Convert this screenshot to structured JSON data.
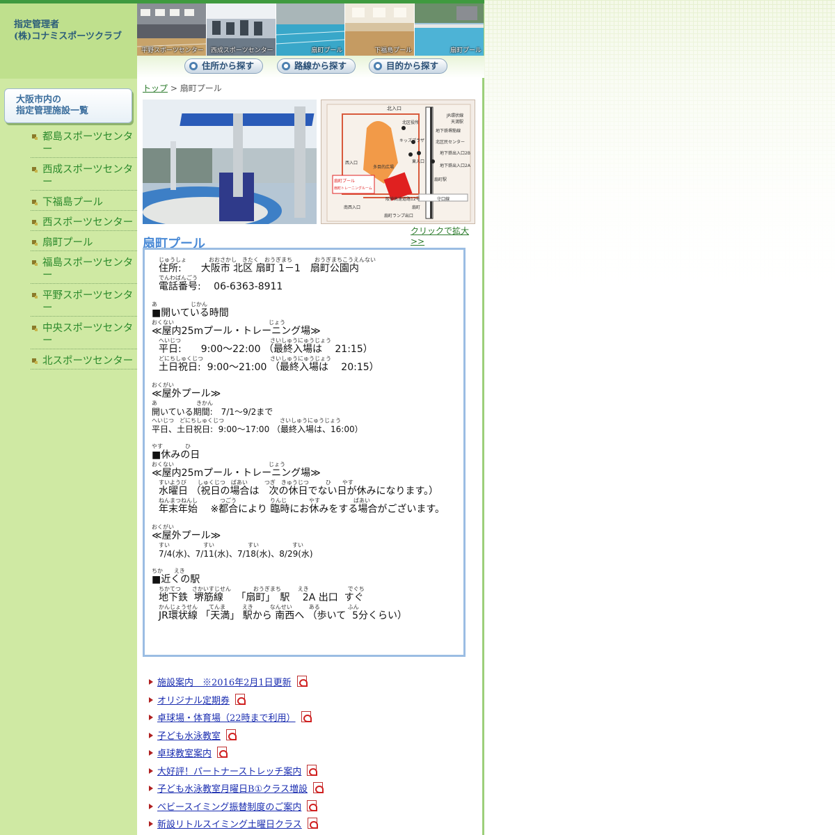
{
  "brand": {
    "line1": "指定管理者",
    "line2": "(株)コナミスポーツクラブ"
  },
  "header_photos": [
    {
      "caption": "平野スポーツセンター"
    },
    {
      "caption": "西成スポーツセンター"
    },
    {
      "caption": "扇町プール"
    },
    {
      "caption": "下福島プール"
    },
    {
      "caption": "扇町プール"
    }
  ],
  "search": {
    "by_address": "住所から探す",
    "by_route": "路線から探す",
    "by_purpose": "目的から探す"
  },
  "sidebar": {
    "heading_line1": "大阪市内の",
    "heading_line2": "指定管理施設一覧",
    "items": [
      {
        "label": "都島スポーツセンター"
      },
      {
        "label": "西成スポーツセンター"
      },
      {
        "label": "下福島プール"
      },
      {
        "label": "西スポーツセンター"
      },
      {
        "label": "扇町プール"
      },
      {
        "label": "福島スポーツセンター"
      },
      {
        "label": "平野スポーツセンター"
      },
      {
        "label": "中央スポーツセンター"
      },
      {
        "label": "北スポーツセンター"
      }
    ]
  },
  "breadcrumb": {
    "top": "トップ",
    "separator": " > ",
    "current": "扇町プール"
  },
  "map": {
    "labels": [
      "北入口",
      "北区役所",
      "JR環状線",
      "天満駅",
      "キッズプラザ",
      "地下鉄堺筋線",
      "北区民センター",
      "地下鉄出入口2B",
      "東入口",
      "地下鉄出入口2A",
      "西入口",
      "多目的広場",
      "扇町駅",
      "扇町プール",
      "扇町トレーニングルーム",
      "阪神高速道路12号",
      "守口線",
      "南西入口",
      "扇町",
      "扇町ランプ出口"
    ]
  },
  "enlarge_link": "クリックで拡大>>",
  "facility_title": "扇町プール",
  "info": {
    "address_ruby": "じゅうしょ　　　　おおさかし　きたく　おうぎまち　　　　おうぎまちこうえんない",
    "address": "住所:　　大阪市 北区 扇町 1－1　扇町公園内",
    "phone_ruby": "でんわばんごう",
    "phone": "電話番号:　 06-6363-8911",
    "hours_ruby": "あ　　　　　　じかん",
    "hours_heading": "■開いている時間",
    "indoor1_ruby": "おくない　　　　　　　　　　　　　　　　　じょう",
    "indoor1_heading": "≪屋内25mプール・トレーニング場≫",
    "weekday_ruby": "へいじつ　　　　　　　　　　　　　　　　さいしゅうにゅうじょう",
    "weekday": "平日:　　9:00～22:00 （最終入場は　 21:15）",
    "weekend_ruby": "どにちしゅくじつ　　　　　　　　　　　　さいしゅうにゅうじょう",
    "weekend": "土日祝日:  9:00～21:00 （最終入場は　 20:15）",
    "outdoor1_ruby": "おくがい",
    "outdoor1_heading": "≪屋外プール≫",
    "period_ruby": "あ　　　　　　　きかん",
    "period": "開いている期間:　7/1～9/2まで",
    "outdoor_time_ruby": "へいじつ　どにちしゅくじつ　　　　　　　　　　さいしゅうにゅうじょう",
    "outdoor_time": "平日、土日祝日:  9:00～17:00 （最終入場は、16:00）",
    "closed_ruby": "やす　　　　ひ",
    "closed_heading": "■休みの日",
    "indoor2_ruby": "おくない　　　　　　　　　　　　　　　　　じょう",
    "indoor2_heading": "≪屋内25mプール・トレーニング場≫",
    "wednesday_ruby": "すいようび　　しゅくじつ　ばあい　　　つぎ　きゅうじつ　　　ひ　　やす",
    "wednesday": "水曜日 （祝日の場合は　次の休日でない日が休みになります。）",
    "yearend_ruby": "ねんまつねんし　　　　つごう　　　　　　りんじ　　　　やす　　　　　　ばあい",
    "yearend": "年末年始　 ※都合により 臨時にお休みをする場合がございます。",
    "outdoor2_ruby": "おくがい",
    "outdoor2_heading": "≪屋外プール≫",
    "outdoor_closed_ruby": "すい　　　　　　すい　　　　　　すい　　　　　　すい",
    "outdoor_closed": "7/4(水)、7/11(水)、7/18(水)、8/29(水)",
    "station_ruby": "ちか　　えき",
    "station_heading": "■近くの駅",
    "subway_ruby": "ちかてつ　　さかいすじせん　　　　おうぎまち　　　えき　　　　　　　でぐち",
    "subway": "地下鉄  堺筋線　 「扇町」　駅　 2A 出口  すぐ",
    "jr_ruby": "かんじょうせん　　てんま　　　えき　　　なんせい　　　ある　　　　　ふん",
    "jr": "JR環状線 「天満」 駅から 南西へ （歩いて  5分くらい）"
  },
  "links": [
    {
      "label": "施設案内　※2016年2月1日更新"
    },
    {
      "label": "オリジナル定期券"
    },
    {
      "label": "卓球場・体育場（22時まで利用）"
    },
    {
      "label": "子ども水泳教室"
    },
    {
      "label": "卓球教室案内"
    },
    {
      "label": "大好評！パートナーストレッチ案内"
    },
    {
      "label": "子ども水泳教室月曜日B①クラス増設"
    },
    {
      "label": "ベビースイミング振替制度のご案内"
    },
    {
      "label": "新設リトルスイミング土曜日クラス"
    }
  ],
  "colors": {
    "sidebar_bg": "#cfe9a3",
    "title_blue": "#4a8ad6",
    "link_blue": "#1a2db0",
    "side_link_green": "#2c8a2c"
  }
}
